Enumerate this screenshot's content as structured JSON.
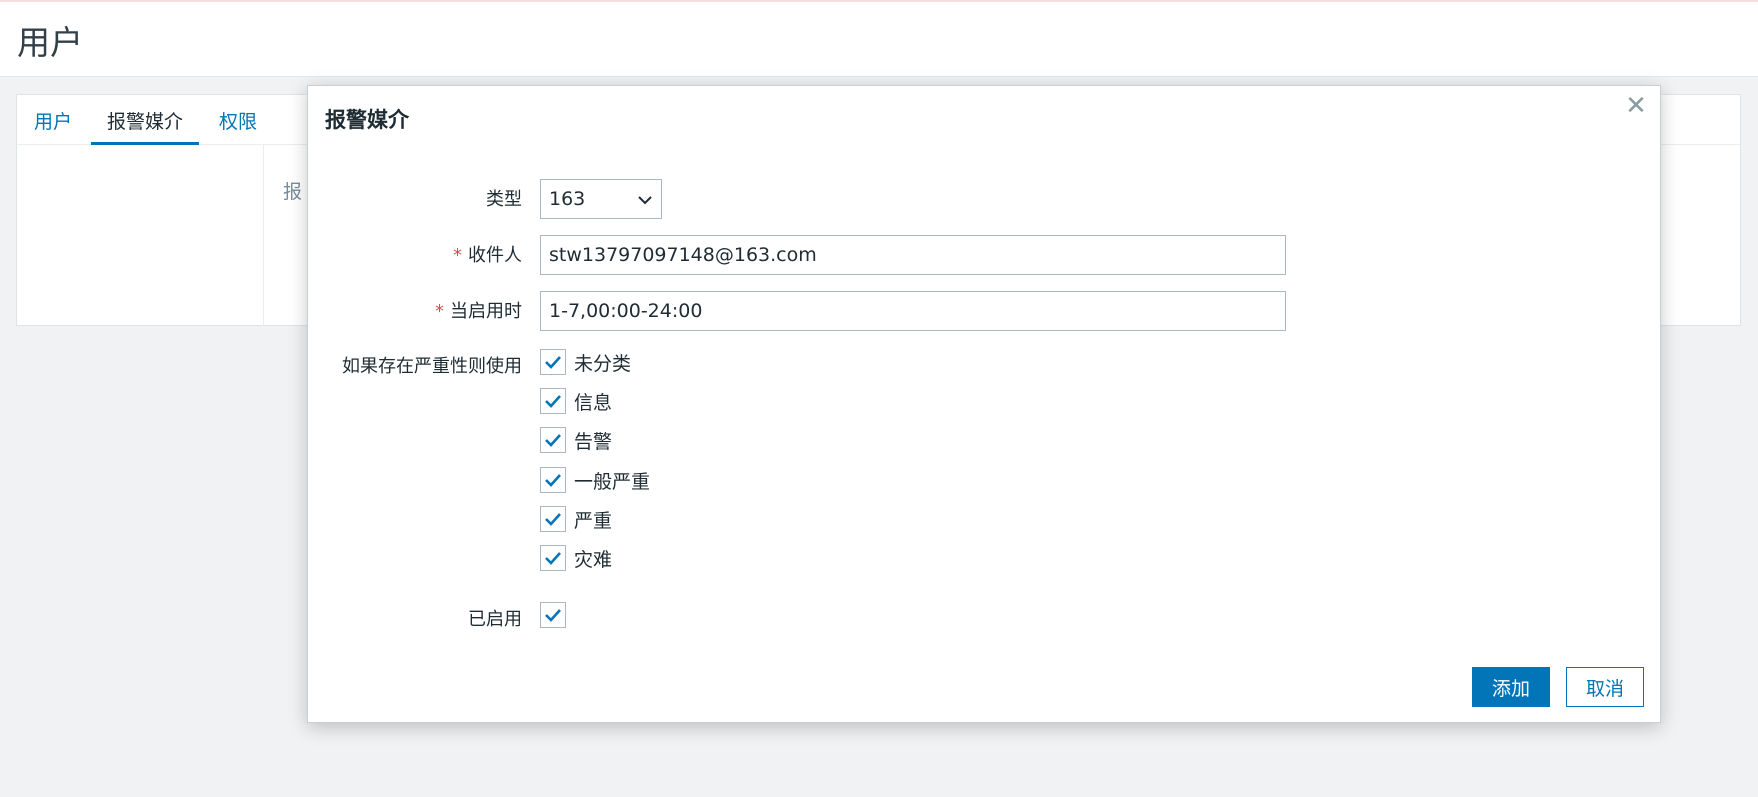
{
  "page": {
    "title": "用户"
  },
  "tabs": [
    {
      "label": "用户",
      "active": false
    },
    {
      "label": "报警媒介",
      "active": true
    },
    {
      "label": "权限",
      "active": false
    }
  ],
  "background": {
    "partial_label": "报"
  },
  "dialog": {
    "title": "报警媒介",
    "close_icon": "close-icon",
    "type": {
      "label": "类型",
      "value": "163"
    },
    "send_to": {
      "label": "收件人",
      "value": "stw13797097148@163.com",
      "required": true
    },
    "when_active": {
      "label": "当启用时",
      "value": "1-7,00:00-24:00",
      "required": true
    },
    "severity": {
      "label": "如果存在严重性则使用",
      "options": [
        {
          "label": "未分类",
          "checked": true
        },
        {
          "label": "信息",
          "checked": true
        },
        {
          "label": "告警",
          "checked": true
        },
        {
          "label": "一般严重",
          "checked": true
        },
        {
          "label": "严重",
          "checked": true
        },
        {
          "label": "灾难",
          "checked": true
        }
      ]
    },
    "enabled": {
      "label": "已启用",
      "checked": true
    },
    "add_label": "添加",
    "cancel_label": "取消"
  },
  "colors": {
    "accent": "#0275b8",
    "required": "#d64e4e",
    "text": "#1f2c33"
  }
}
